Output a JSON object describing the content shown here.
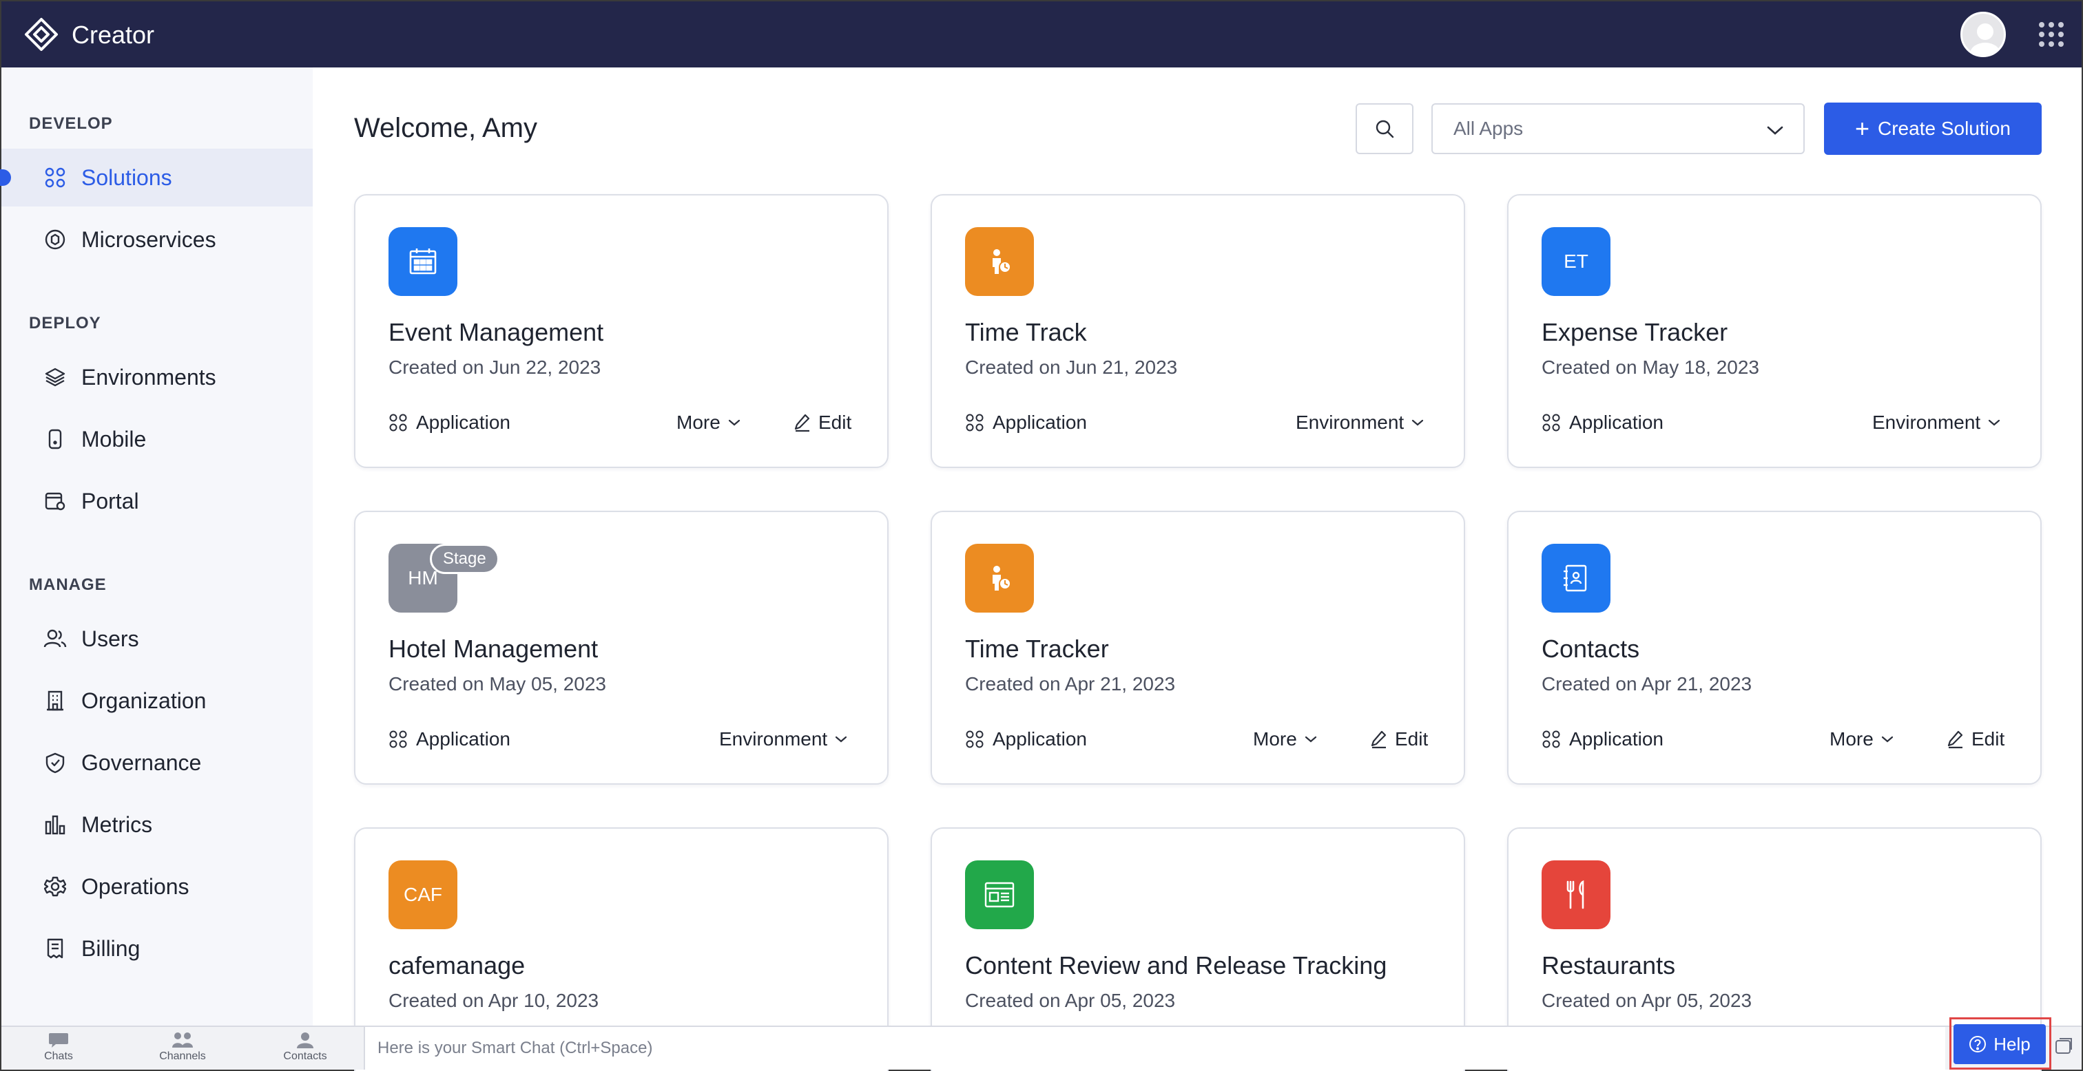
{
  "app": {
    "title": "Creator"
  },
  "sidebar": {
    "sections": [
      {
        "title": "DEVELOP"
      },
      {
        "title": "DEPLOY"
      },
      {
        "title": "MANAGE"
      }
    ],
    "items": [
      {
        "label": "Solutions",
        "icon": "solutions-icon"
      },
      {
        "label": "Microservices",
        "icon": "microservices-icon"
      },
      {
        "label": "Environments",
        "icon": "layers-icon"
      },
      {
        "label": "Mobile",
        "icon": "mobile-icon"
      },
      {
        "label": "Portal",
        "icon": "portal-icon"
      },
      {
        "label": "Users",
        "icon": "users-icon"
      },
      {
        "label": "Organization",
        "icon": "building-icon"
      },
      {
        "label": "Governance",
        "icon": "shield-icon"
      },
      {
        "label": "Metrics",
        "icon": "bar-chart-icon"
      },
      {
        "label": "Operations",
        "icon": "gear-icon"
      },
      {
        "label": "Billing",
        "icon": "receipt-icon"
      }
    ]
  },
  "header": {
    "welcome": "Welcome, Amy",
    "filter_selected": "All Apps",
    "create_label": "Create Solution"
  },
  "cards": [
    {
      "name": "Event Management",
      "date": "Created on Jun 22, 2023",
      "type": "Application",
      "action": "More",
      "edit": "Edit",
      "icon": "calendar-icon",
      "color": "#1f78f0"
    },
    {
      "name": "Time Track",
      "date": "Created on Jun 21, 2023",
      "type": "Application",
      "action": "Environment",
      "icon": "person-clock-icon",
      "color": "#ec8c22"
    },
    {
      "name": "Expense Tracker",
      "date": "Created on May 18, 2023",
      "type": "Application",
      "action": "Environment",
      "initials": "ET",
      "color": "#1f78f0"
    },
    {
      "name": "Hotel Management",
      "date": "Created on May 05, 2023",
      "type": "Application",
      "action": "Environment",
      "initials": "HM",
      "badge": "Stage",
      "color": "#8a8e9a"
    },
    {
      "name": "Time Tracker",
      "date": "Created on Apr 21, 2023",
      "type": "Application",
      "action": "More",
      "edit": "Edit",
      "icon": "person-clock-icon",
      "color": "#ec8c22"
    },
    {
      "name": "Contacts",
      "date": "Created on Apr 21, 2023",
      "type": "Application",
      "action": "More",
      "edit": "Edit",
      "icon": "contact-book-icon",
      "color": "#1f78f0"
    },
    {
      "name": "cafemanage",
      "date": "Created on Apr 10, 2023",
      "initials": "CAF",
      "color": "#ec8c22"
    },
    {
      "name": "Content Review and Release Tracking",
      "date": "Created on Apr 05, 2023",
      "icon": "browser-window-icon",
      "color": "#22a84a"
    },
    {
      "name": "Restaurants",
      "date": "Created on Apr 05, 2023",
      "icon": "fork-knife-icon",
      "color": "#e5453b"
    }
  ],
  "bottombar": {
    "items": [
      {
        "label": "Chats"
      },
      {
        "label": "Channels"
      },
      {
        "label": "Contacts"
      }
    ],
    "smartchat_placeholder": "Here is your Smart Chat (Ctrl+Space)",
    "help_label": "Help"
  },
  "colors": {
    "topbar": "#23264a",
    "accent": "#2c5ce6",
    "sidebar_bg": "#f6f7fb",
    "help_outline": "#e04646"
  }
}
